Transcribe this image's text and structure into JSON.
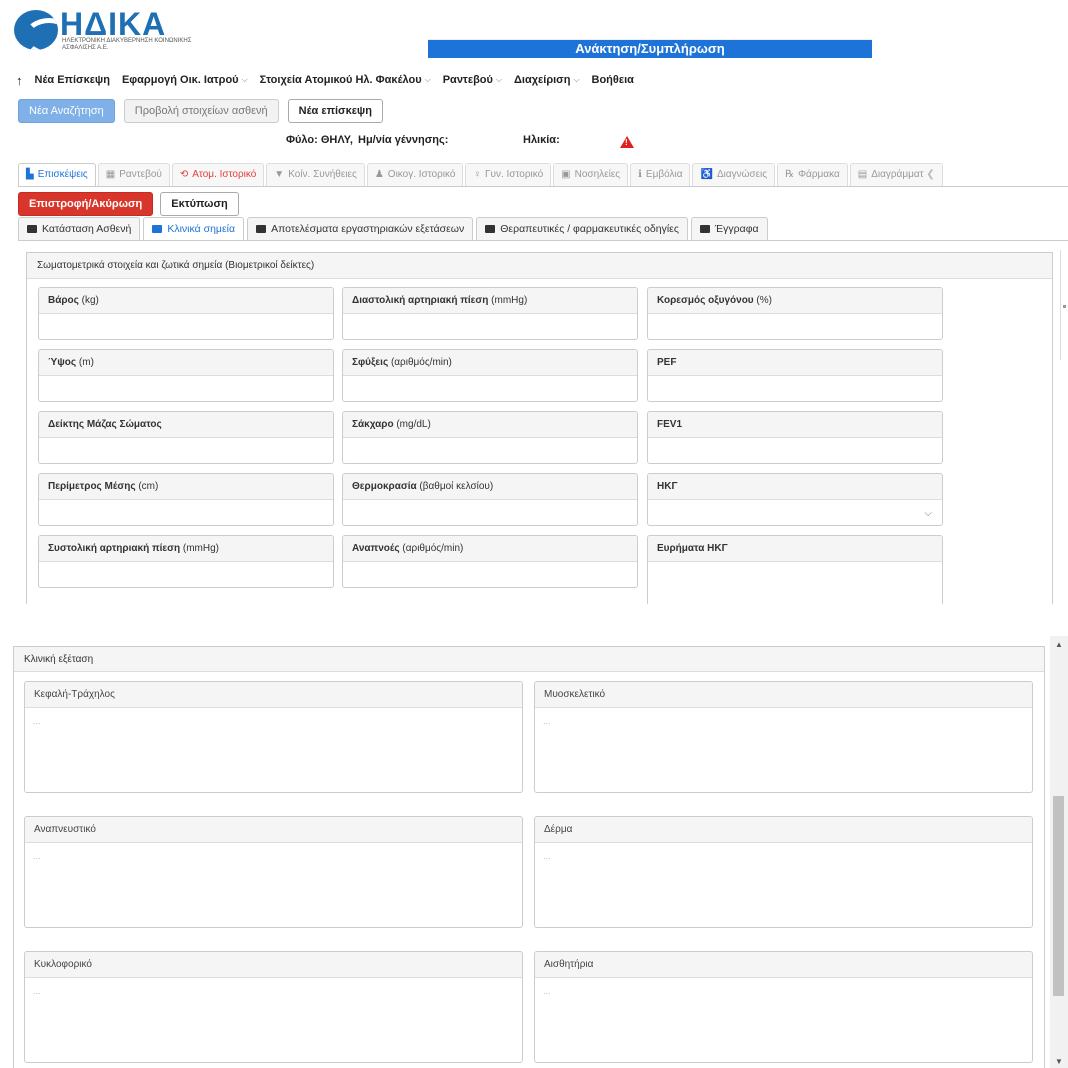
{
  "header": {
    "brand": "ΗΔΙΚΑ",
    "brand_sub": "ΗΛΕΚΤΡΟΝΙΚΗ ΔΙΑΚΥΒΕΡΝΗΣΗ ΚΟΙΝΩΝΙΚΗΣ ΑΣΦΑΛΙΣΗΣ Α.Ε.",
    "banner": "Ανάκτηση/Συμπλήρωση"
  },
  "menu": {
    "items": [
      {
        "label": "Νέα Επίσκεψη",
        "caret": false
      },
      {
        "label": "Εφαρμογή Οικ. Ιατρού",
        "caret": true
      },
      {
        "label": "Στοιχεία Ατομικού Ηλ. Φακέλου",
        "caret": true
      },
      {
        "label": "Ραντεβού",
        "caret": true
      },
      {
        "label": "Διαχείριση",
        "caret": true
      },
      {
        "label": "Βοήθεια",
        "caret": false
      }
    ]
  },
  "actions": {
    "new_search": "Νέα Αναζήτηση",
    "view_patient": "Προβολή στοιχείων ασθενή",
    "new_visit": "Νέα επίσκεψη"
  },
  "patient": {
    "gender": "Φύλο: ΘΗΛΥ,",
    "birth": "Ημ/νία γέννησης:",
    "age": "Ηλικία:"
  },
  "main_tabs": [
    {
      "label": "Επισκέψεις",
      "icon": "visits-icon"
    },
    {
      "label": "Ραντεβού",
      "icon": "calendar-icon"
    },
    {
      "label": "Ατομ. Ιστορικό",
      "icon": "history-icon"
    },
    {
      "label": "Κοίν. Συνήθειες",
      "icon": "filter-icon"
    },
    {
      "label": "Οικογ. Ιστορικό",
      "icon": "family-icon"
    },
    {
      "label": "Γυν. Ιστορικό",
      "icon": "female-icon"
    },
    {
      "label": "Νοσηλείες",
      "icon": "hospital-icon"
    },
    {
      "label": "Εμβόλια",
      "icon": "vaccine-icon"
    },
    {
      "label": "Διαγνώσεις",
      "icon": "diagnosis-icon"
    },
    {
      "label": "Φάρμακα",
      "icon": "pill-icon"
    },
    {
      "label": "Διαγράμματ",
      "icon": "chart-icon"
    }
  ],
  "form_actions": {
    "cancel": "Επιστροφή/Ακύρωση",
    "print": "Εκτύπωση"
  },
  "sub_tabs": [
    "Κατάσταση Ασθενή",
    "Κλινικά σημεία",
    "Αποτελέσματα εργαστηριακών εξετάσεων",
    "Θεραπευτικές / φαρμακευτικές οδηγίες",
    "Έγγραφα"
  ],
  "vitals": {
    "title": "Σωματομετρικά στοιχεία και ζωτικά σημεία (Βιομετρικοί δείκτες)",
    "fields": [
      {
        "name": "Βάρος",
        "unit": "(kg)"
      },
      {
        "name": "Διαστολική αρτηριακή πίεση",
        "unit": "(mmHg)"
      },
      {
        "name": "Κορεσμός οξυγόνου",
        "unit": "(%)"
      },
      {
        "name": "Ύψος",
        "unit": "(m)"
      },
      {
        "name": "Σφύξεις",
        "unit": "(αριθμός/min)"
      },
      {
        "name": "PEF",
        "unit": ""
      },
      {
        "name": "Δείκτης Μάζας Σώματος",
        "unit": ""
      },
      {
        "name": "Σάκχαρο",
        "unit": "(mg/dL)"
      },
      {
        "name": "FEV1",
        "unit": ""
      },
      {
        "name": "Περίμετρος Μέσης",
        "unit": "(cm)"
      },
      {
        "name": "Θερμοκρασία",
        "unit": "(βαθμοί κελσίου)"
      },
      {
        "name": "ΗΚΓ",
        "unit": ""
      },
      {
        "name": "Συστολική αρτηριακή πίεση",
        "unit": "(mmHg)"
      },
      {
        "name": "Αναπνοές",
        "unit": "(αριθμός/min)"
      },
      {
        "name": "Ευρήματα ΗΚΓ",
        "unit": ""
      }
    ]
  },
  "exam": {
    "title": "Κλινική εξέταση",
    "placeholder": "...",
    "sections": [
      "Κεφαλή-Τράχηλος",
      "Μυοσκελετικό",
      "Αναπνευστικό",
      "Δέρμα",
      "Κυκλοφορικό",
      "Αισθητήρια"
    ]
  }
}
